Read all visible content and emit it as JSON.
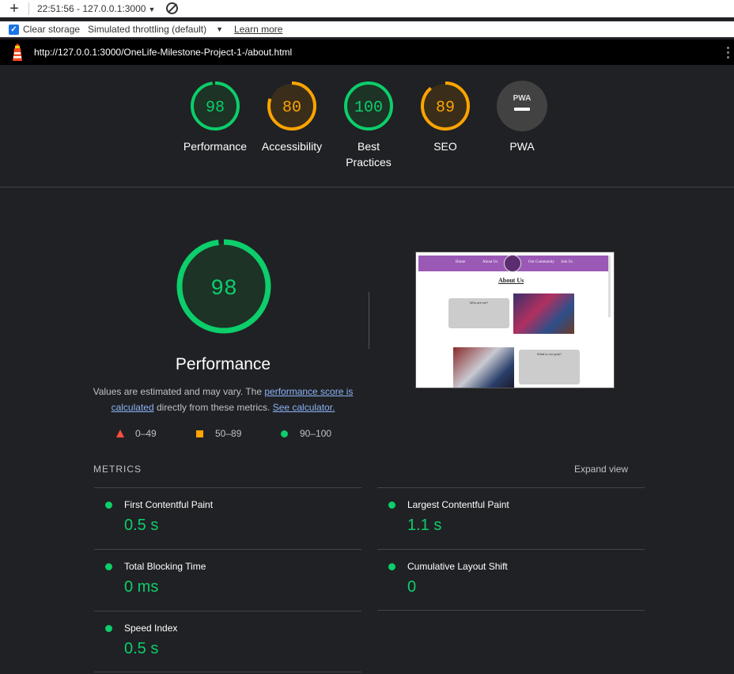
{
  "toolbar": {
    "plus": "+",
    "session": "22:51:56 - 127.0.0.1:3000",
    "clear_storage": "Clear storage",
    "throttling": "Simulated throttling (default)",
    "learn_more": "Learn more"
  },
  "report": {
    "url": "http://127.0.0.1:3000/OneLife-Milestone-Project-1-/about.html"
  },
  "colors": {
    "pass": "#0cce6b",
    "average": "#ffa400",
    "fail": "#ff4e42",
    "pwa": "#9aa0a6"
  },
  "gauges": [
    {
      "label": "Performance",
      "score": "98",
      "status": "pass"
    },
    {
      "label": "Accessibility",
      "score": "80",
      "status": "average"
    },
    {
      "label": "Best Practices",
      "score": "100",
      "status": "pass"
    },
    {
      "label": "SEO",
      "score": "89",
      "status": "average"
    },
    {
      "label": "PWA",
      "score": "PWA",
      "status": "pwa"
    }
  ],
  "performance": {
    "score": "98",
    "title": "Performance",
    "note_1": "Values are estimated and may vary. The ",
    "note_link_1": "performance score is calculated",
    "note_2": " directly from these metrics. ",
    "note_link_2": "See calculator.",
    "legend": [
      {
        "range": "0–49",
        "shape": "triangle"
      },
      {
        "range": "50–89",
        "shape": "square"
      },
      {
        "range": "90–100",
        "shape": "circle"
      }
    ]
  },
  "thumbnail": {
    "nav": [
      "Home",
      "About Us",
      "Our Community",
      "Join Us"
    ],
    "heading": "About Us",
    "card1_title": "Who are we?",
    "card2_title": "What is our goal?"
  },
  "metrics": {
    "heading": "METRICS",
    "expand": "Expand view",
    "items": [
      {
        "label": "First Contentful Paint",
        "value": "0.5 s"
      },
      {
        "label": "Largest Contentful Paint",
        "value": "1.1 s"
      },
      {
        "label": "Total Blocking Time",
        "value": "0 ms"
      },
      {
        "label": "Cumulative Layout Shift",
        "value": "0"
      },
      {
        "label": "Speed Index",
        "value": "0.5 s"
      }
    ]
  }
}
